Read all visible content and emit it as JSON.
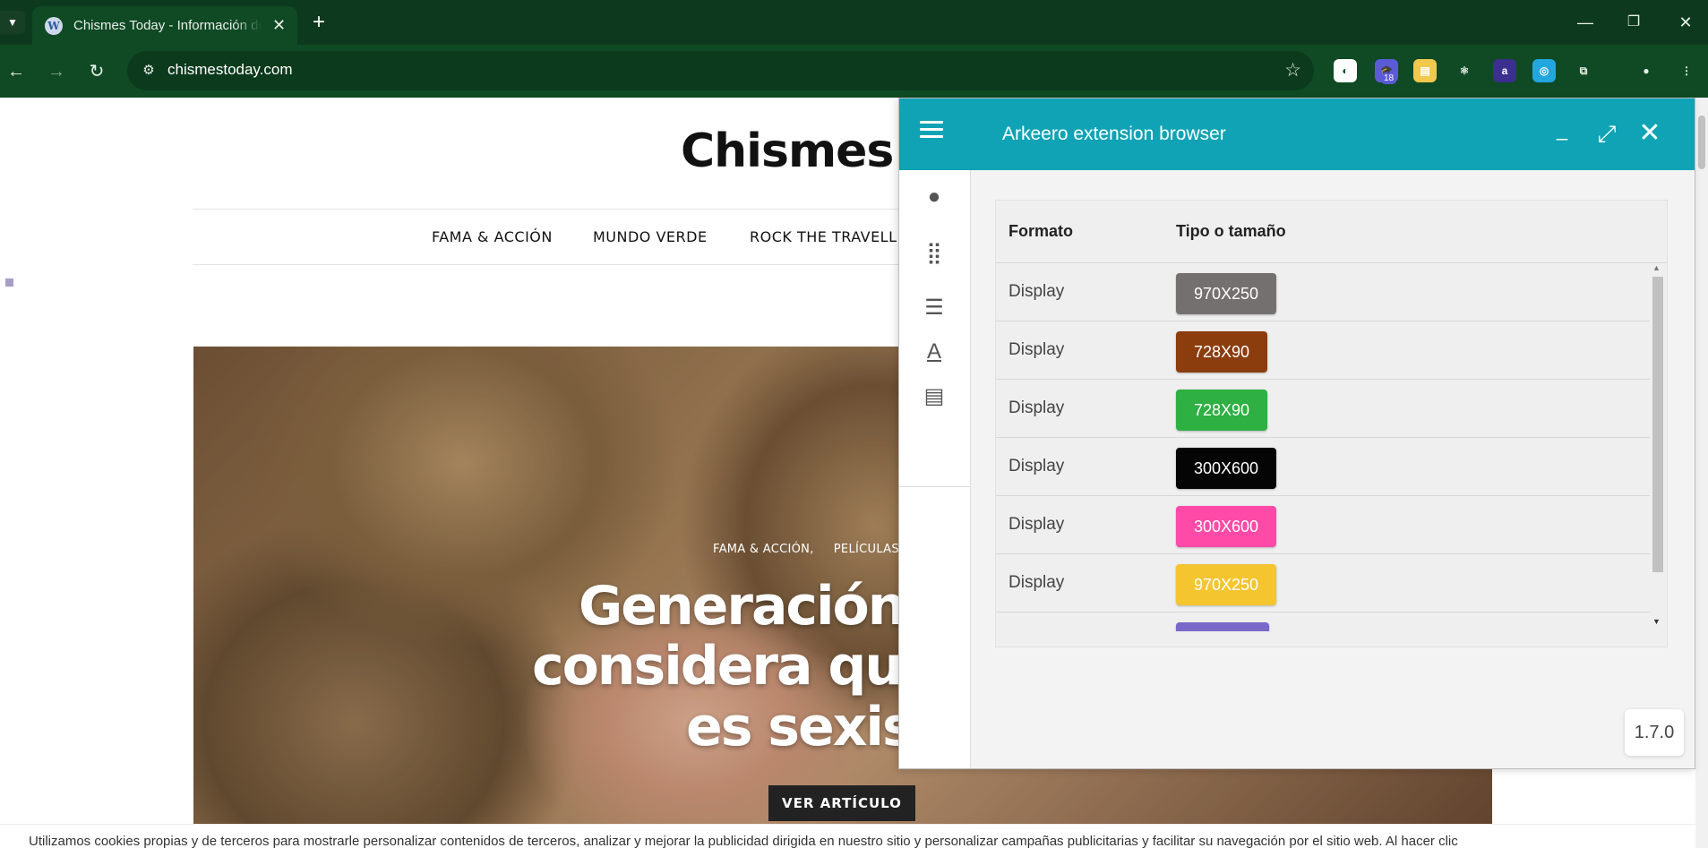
{
  "browser": {
    "tab_title": "Chismes Today - Información de",
    "tab_favicon": "W",
    "url": "chismestoday.com",
    "icons": {
      "tab_list": "chevron-down-icon",
      "close_tab": "close-icon",
      "new_tab": "plus-icon",
      "back": "arrow-left-icon",
      "forward": "arrow-right-icon",
      "reload": "reload-icon",
      "site_info": "tune-icon",
      "bookmark": "star-icon"
    },
    "window_controls": [
      "minimize-icon",
      "restore-icon",
      "close-icon"
    ],
    "extensions": [
      {
        "name": "ext-circle-icon",
        "label": "◐",
        "color": "#ffffff"
      },
      {
        "name": "ext-hat-icon",
        "label": "🎓",
        "color": "#5b5bd6",
        "badge": "18"
      },
      {
        "name": "ext-note-icon",
        "label": "▤",
        "color": "#f2c94c"
      },
      {
        "name": "ext-react-icon",
        "label": "⚛",
        "color": "#0f4a25"
      },
      {
        "name": "ext-a-icon",
        "label": "a",
        "color": "#3b2f8f"
      },
      {
        "name": "ext-target-icon",
        "label": "◎",
        "color": "#23a6e0"
      },
      {
        "name": "extensions-puzzle-icon",
        "label": "⧉",
        "color": "#0f4a25"
      },
      {
        "name": "profile-icon",
        "label": "●",
        "color": "#0f4a25"
      },
      {
        "name": "menu-dots-icon",
        "label": "⋮",
        "color": "#0f4a25"
      }
    ]
  },
  "site": {
    "title": "Chismes T",
    "nav": [
      "FAMA & ACCIÓN",
      "MUNDO VERDE",
      "ROCK THE TRAVELL"
    ],
    "hero": {
      "categories": "FAMA & ACCIÓN,     PELÍCULAS,",
      "headline": [
        "Generación c",
        "considera que",
        "es sexist"
      ],
      "button": "VER ARTÍCULO"
    },
    "cookie_text": "Utilizamos cookies propias y de terceros para mostrarle personalizar contenidos de terceros, analizar y mejorar la publicidad dirigida en nuestro sitio y personalizar campañas publicitarias y facilitar su navegación por el sitio web. Al hacer clic"
  },
  "extension": {
    "title": "Arkeero extension browser",
    "icons": {
      "menu": "hamburger-menu-icon",
      "minimize": "minimize-icon",
      "maximize": "expand-icon",
      "close": "close-icon"
    },
    "sidebar": [
      {
        "name": "palette-icon",
        "glyph": "🎨"
      },
      {
        "name": "apps-alert-icon",
        "glyph": "⣿"
      },
      {
        "name": "list-icon",
        "glyph": "☰"
      },
      {
        "name": "text-format-icon",
        "glyph": "A"
      },
      {
        "name": "article-icon",
        "glyph": "▤"
      }
    ],
    "table": {
      "headers": [
        "Formato",
        "Tipo o tamaño"
      ],
      "rows": [
        {
          "format": "Display",
          "size": "970X250",
          "color": "#757070"
        },
        {
          "format": "Display",
          "size": "728X90",
          "color": "#8b3d0e"
        },
        {
          "format": "Display",
          "size": "728X90",
          "color": "#2eb043"
        },
        {
          "format": "Display",
          "size": "300X600",
          "color": "#050505"
        },
        {
          "format": "Display",
          "size": "300X600",
          "color": "#ff4aa8"
        },
        {
          "format": "Display",
          "size": "970X250",
          "color": "#f4c52f"
        },
        {
          "format": "",
          "size": "",
          "color": "#7a68c8"
        }
      ]
    },
    "version": "1.7.0"
  }
}
